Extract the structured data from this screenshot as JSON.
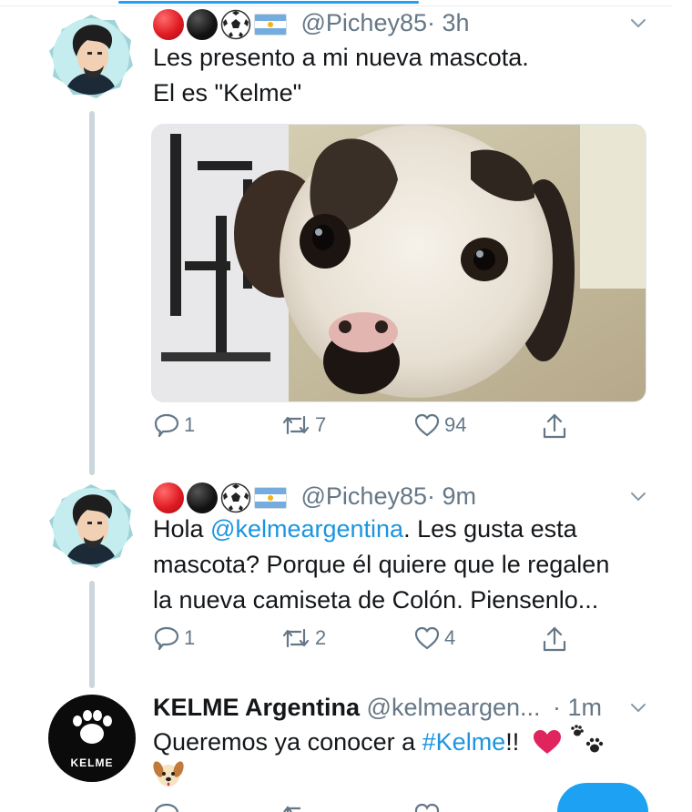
{
  "tweets": [
    {
      "handle": "@Pichey85",
      "time": "· 3h",
      "text_line1": "Les presento a mi nueva mascota.",
      "text_line2": "El es \"Kelme\"",
      "replies": "1",
      "retweets": "7",
      "likes": "94"
    },
    {
      "handle": "@Pichey85",
      "time": "· 9m",
      "text_line1_prefix": "Hola ",
      "mention": "@kelmeargentina",
      "text_line1_suffix": ". Les gusta esta",
      "text_line2": "mascota? Porque él quiere que le regalen",
      "text_line3": "la nueva camiseta de Colón. Piensenlo...",
      "replies": "1",
      "retweets": "2",
      "likes": "4"
    },
    {
      "name": "KELME Argentina",
      "handle": "@kelmeargen...",
      "time": "· 1m",
      "text_prefix": "Queremos ya conocer a ",
      "hashtag": "#Kelme",
      "text_suffix": "!!",
      "avatar_label": "KELME"
    }
  ],
  "icons": {
    "flair": [
      "red-circle-icon",
      "black-circle-icon",
      "soccer-ball-icon",
      "argentina-flag-icon"
    ],
    "actions": [
      "reply-icon",
      "retweet-icon",
      "like-icon",
      "share-icon"
    ],
    "menu": "chevron-down-icon"
  },
  "colors": {
    "link": "#1b95e0",
    "muted": "#657786",
    "accent": "#1da1f2",
    "heart": "#e0245e"
  }
}
